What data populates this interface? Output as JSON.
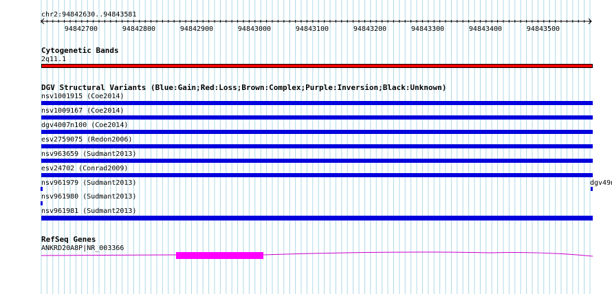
{
  "ruler": {
    "location": "chr2:94842630..94843581",
    "ticks": [
      "94842700",
      "94842800",
      "94842900",
      "94843000",
      "94843100",
      "94843200",
      "94843300",
      "94843400",
      "94843500"
    ]
  },
  "tracks": {
    "cytoband": {
      "title": "Cytogenetic Bands",
      "band_label": "2q11.1",
      "color": "#ff0000"
    },
    "dgv": {
      "title": "DGV Structural Variants (Blue:Gain;Red:Loss;Brown:Complex;Purple:Inversion;Black:Unknown)",
      "gain_color": "#0000dd",
      "features": [
        {
          "label": "nsv1001915 (Coe2014)"
        },
        {
          "label": "nsv1009167 (Coe2014)"
        },
        {
          "label": "dgv4007n100 (Coe2014)"
        },
        {
          "label": "esv2759075 (Redon2006)"
        },
        {
          "label": "nsv963659 (Sudmant2013)"
        },
        {
          "label": "esv24702 (Conrad2009)"
        },
        {
          "label": "nsv961979 (Sudmant2013)"
        },
        {
          "label": "nsv961980 (Sudmant2013)"
        },
        {
          "label": "nsv961981 (Sudmant2013)"
        }
      ],
      "edge_label": "dgv49n"
    },
    "refseq": {
      "title": "RefSeq Genes",
      "gene_label": "ANKRD20A8P|NR_003366",
      "color": "#ff00ff"
    }
  }
}
